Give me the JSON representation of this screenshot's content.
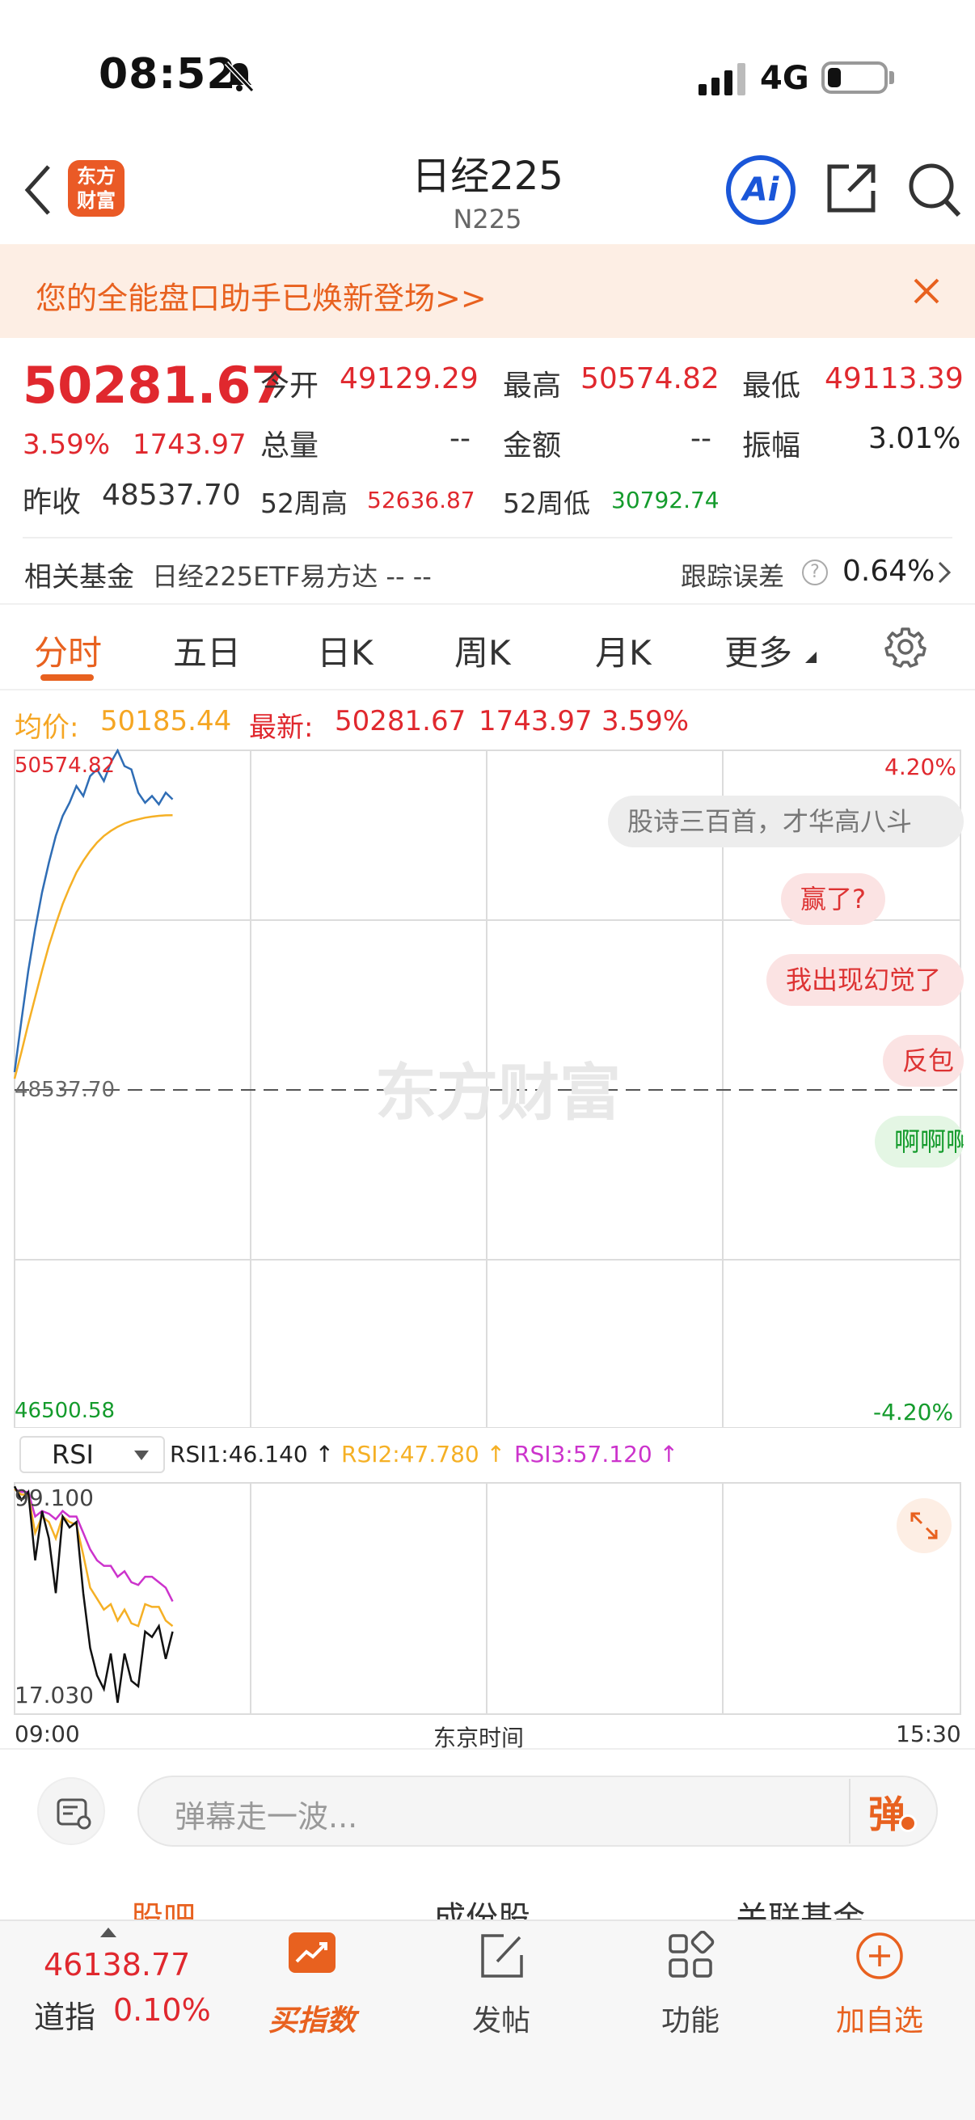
{
  "status": {
    "time": "08:52",
    "network": "4G"
  },
  "header": {
    "logo": "东方财富",
    "title": "日经225",
    "subtitle": "N225"
  },
  "banner": {
    "text": "您的全能盘口助手已焕新登场>>"
  },
  "quote": {
    "price": "50281.67",
    "change_pct": "3.59%",
    "change": "1743.97",
    "open_label": "今开",
    "open": "49129.29",
    "high_label": "最高",
    "high": "50574.82",
    "low_label": "最低",
    "low": "49113.39",
    "volume_label": "总量",
    "volume": "--",
    "amount_label": "金额",
    "amount": "--",
    "amplitude_label": "振幅",
    "amplitude": "3.01%",
    "prev_close_label": "昨收",
    "prev_close": "48537.70",
    "w52_high_label": "52周高",
    "w52_high": "52636.87",
    "w52_low_label": "52周低",
    "w52_low": "30792.74"
  },
  "fund": {
    "label": "相关基金",
    "name": "日经225ETF易方达 -- --",
    "error_label": "跟踪误差",
    "error_value": "0.64%"
  },
  "tabs": [
    "分时",
    "五日",
    "日K",
    "周K",
    "月K",
    "更多"
  ],
  "info_line": {
    "avg_label": "均价:",
    "avg": "50185.44",
    "latest_label": "最新:",
    "latest": "50281.67",
    "chg": "1743.97",
    "pct": "3.59%"
  },
  "chart_data": {
    "type": "line",
    "title": "",
    "y_top_label": "50574.82",
    "y_bottom_label": "46500.58",
    "y_mid_label": "48537.70",
    "pct_top": "4.20%",
    "pct_bottom": "-4.20%",
    "watermark": "东方财富",
    "x_start": "09:00",
    "x_end": "15:30",
    "x_label": "东京时间",
    "ylim": [
      46500.58,
      50574.82
    ],
    "series": [
      {
        "values": [
          48640,
          48950,
          49250,
          49500,
          49720,
          49900,
          50060,
          50180,
          50260,
          50360,
          50300,
          50420,
          50460,
          50390,
          50500,
          50574,
          50480,
          50460,
          50320,
          50260,
          50300,
          50250,
          50320,
          50280
        ]
      },
      {
        "values": [
          48600,
          48760,
          48930,
          49090,
          49250,
          49400,
          49530,
          49650,
          49750,
          49840,
          49910,
          49970,
          50020,
          50060,
          50090,
          50115,
          50135,
          50150,
          50160,
          50170,
          50176,
          50181,
          50184,
          50185
        ]
      }
    ]
  },
  "danmaku": [
    "股诗三百首，才华高八斗",
    "赢了?",
    "我出现幻觉了",
    "反包",
    "啊啊啊"
  ],
  "rsi": {
    "select": "RSI",
    "rsi1": "RSI1:46.140 ↑",
    "rsi2": "RSI2:47.780 ↑",
    "rsi3": "RSI3:57.120 ↑",
    "top_label": "99.100",
    "bottom_label": "17.030",
    "ylim": [
      17.03,
      99.1
    ],
    "rsi1_values": [
      99,
      94,
      97,
      72,
      90,
      80,
      60,
      88,
      84,
      86,
      60,
      40,
      30,
      25,
      38,
      20,
      38,
      28,
      26,
      46,
      44,
      48,
      36,
      46
    ],
    "rsi2_values": [
      98,
      96,
      96,
      82,
      88,
      86,
      80,
      88,
      86,
      85,
      74,
      62,
      58,
      54,
      56,
      50,
      54,
      49,
      48,
      56,
      55,
      55,
      50,
      48
    ],
    "rsi3_values": [
      98,
      97,
      97,
      88,
      90,
      89,
      87,
      90,
      88,
      88,
      82,
      76,
      72,
      70,
      70,
      66,
      68,
      64,
      63,
      66,
      66,
      64,
      62,
      57
    ]
  },
  "comment": {
    "placeholder": "弹幕走一波...",
    "send": "弹"
  },
  "subtabs": [
    "股吧",
    "成份股",
    "关联基金"
  ],
  "bottom_nav": {
    "index_value": "46138.77",
    "index_name": "道指",
    "index_pct": "0.10%",
    "items": [
      "买指数",
      "发帖",
      "功能",
      "加自选"
    ]
  },
  "colors": {
    "red": "#e0282e",
    "green": "#149b2c",
    "orange": "#e8611f",
    "price_line": "#2f6db5",
    "avg_line": "#f5b025",
    "rsi3": "#cc33cc"
  }
}
